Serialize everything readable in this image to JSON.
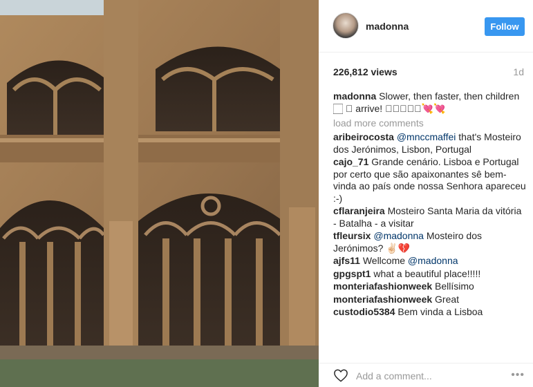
{
  "post": {
    "media_alt": "cloister arches"
  },
  "header": {
    "username": "madonna",
    "follow_label": "Follow"
  },
  "stats": {
    "views": "226,812 views",
    "age": "1d"
  },
  "caption": {
    "user": "madonna",
    "text": "Slower, then faster, then children 🏻 🏻 arrive! 🏻🏻🏻🏻🏻💘💘"
  },
  "load_more": "load more comments",
  "comments": [
    {
      "user": "aribeirocosta",
      "mention": "@mnccmaffei",
      "text": " that's Mosteiro dos Jerónimos, Lisbon, Portugal"
    },
    {
      "user": "cajo_71",
      "mention": "",
      "text": "Grande cenário. Lisboa e Portugal por certo que são apaixonantes sê bem-vinda ao país onde nossa Senhora apareceu :-)"
    },
    {
      "user": "cflaranjeira",
      "mention": "",
      "text": "Mosteiro Santa Maria da vitória - Batalha - a visitar"
    },
    {
      "user": "tfleursix",
      "mention": "@madonna",
      "text": " Mosteiro dos Jerónimos? ✌🏻💔"
    },
    {
      "user": "ajfs11",
      "mention": "",
      "text": "Wellcome ",
      "mention_after": "@madonna"
    },
    {
      "user": "gpgspt1",
      "mention": "",
      "text": "what a beautiful place!!!!!"
    },
    {
      "user": "monteriafashionweek",
      "mention": "",
      "text": "Bellísimo"
    },
    {
      "user": "monteriafashionweek",
      "mention": "",
      "text": "Great"
    },
    {
      "user": "custodio5384",
      "mention": "",
      "text": "Bem vinda a Lisboa"
    }
  ],
  "footer": {
    "add_comment_placeholder": "Add a comment...",
    "more_label": "•••"
  },
  "icons": {
    "like": "heart-icon",
    "more": "more-options-icon"
  },
  "colors": {
    "accent": "#3897f0",
    "mention": "#003569",
    "muted": "#999999"
  }
}
